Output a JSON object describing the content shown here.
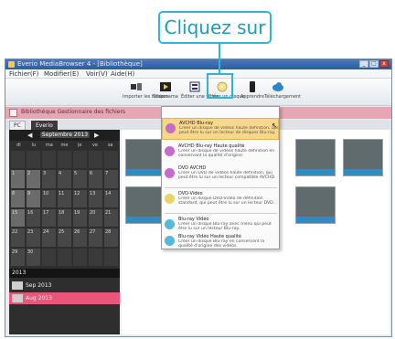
{
  "callout": {
    "text": "Cliquez sur"
  },
  "window": {
    "title": "Everio MediaBrowser 4 - [Bibliothèque]",
    "buttons": [
      "_",
      "□",
      "x"
    ]
  },
  "menubar": {
    "items": [
      "Fichier(F)",
      "Modifier(E)",
      "Voir(V)",
      "Aide(H)"
    ]
  },
  "toolbar": {
    "items": [
      {
        "label": "Importer les fichiers",
        "icon": "import-icon"
      },
      {
        "label": "Diaporama",
        "icon": "slideshow-icon"
      },
      {
        "label": "Éditer une vidéo",
        "icon": "edit-video-icon"
      },
      {
        "label": "Créer un disque",
        "icon": "disc-icon"
      },
      {
        "label": "Apprendre",
        "icon": "phone-icon"
      },
      {
        "label": "Téléchargement",
        "icon": "cloud-icon"
      }
    ]
  },
  "pinkbar": {
    "text": "Bibliothèque  Gestionnaire des fichiers"
  },
  "tabs": [
    {
      "label": "PC"
    },
    {
      "label": "Everio"
    }
  ],
  "calendar": {
    "month": "Septembre 2013",
    "prev": "◀",
    "next": "▶",
    "days": [
      "di",
      "lu",
      "ma",
      "me",
      "je",
      "ve",
      "sa"
    ],
    "cells": [
      "",
      "",
      "",
      "",
      "",
      "",
      "",
      "1",
      "2",
      "3",
      "4",
      "5",
      "6",
      "7",
      "8",
      "9",
      "10",
      "11",
      "12",
      "13",
      "14",
      "15",
      "16",
      "17",
      "18",
      "19",
      "20",
      "21",
      "22",
      "23",
      "24",
      "25",
      "26",
      "27",
      "28",
      "29",
      "30",
      "",
      "",
      "",
      "",
      ""
    ]
  },
  "sidebar_list": {
    "year": "2013",
    "items": [
      {
        "label": "Sep 2013"
      },
      {
        "label": "Aug 2013"
      }
    ]
  },
  "dropdown": {
    "items": [
      {
        "title": "AVCHD Blu-ray",
        "desc": "Créer un disque de vidéos haute définition, qui peut être lu sur un lecteur de disques Blu-ray."
      },
      {
        "title": "AVCHD Blu-ray Haute qualité",
        "desc": "Créer un disque de vidéos haute définition en conservant la qualité d'origine."
      },
      {
        "title": "DVD AVCHD",
        "desc": "Créer un DVD de vidéos haute définition, qui peut être lu sur un lecteur compatible AVCHD."
      },
      {
        "title": "DVD-Vidéo",
        "desc": "Créer un disque DVD-Vidéo de définition standard, qui peut être lu sur un lecteur DVD."
      },
      {
        "title": "Blu-ray Vidéo",
        "desc": "Créer un disque Blu-ray avec menu qui peut être lu sur un lecteur Blu-ray."
      },
      {
        "title": "Blu-ray Vidéo Haute qualité",
        "desc": "Créer un disque Blu-ray en conservant la qualité d'origine des vidéos."
      }
    ]
  },
  "colors": {
    "accent": "#2fb6d5",
    "pink": "#e7a6b4",
    "highlight": "#f7d88a"
  }
}
